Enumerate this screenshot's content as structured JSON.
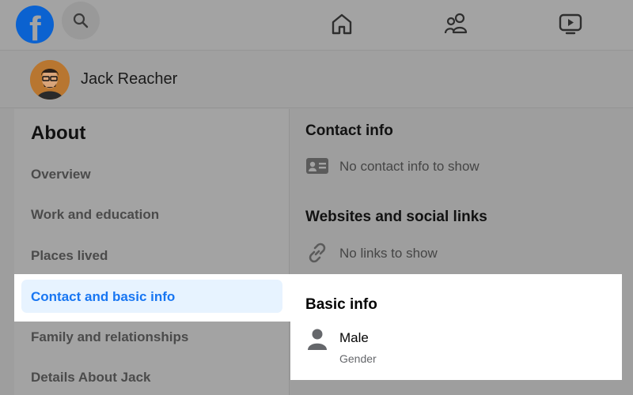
{
  "profile": {
    "name": "Jack Reacher"
  },
  "about": {
    "title": "About",
    "menu": [
      {
        "label": "Overview",
        "active": false
      },
      {
        "label": "Work and education",
        "active": false
      },
      {
        "label": "Places lived",
        "active": false
      },
      {
        "label": "Contact and basic info",
        "active": true
      },
      {
        "label": "Family and relationships",
        "active": false
      },
      {
        "label": "Details About Jack",
        "active": false
      }
    ]
  },
  "contact": {
    "title": "Contact info",
    "empty": "No contact info to show"
  },
  "websites": {
    "title": "Websites and social links",
    "empty": "No links to show"
  },
  "basic": {
    "title": "Basic info",
    "gender_value": "Male",
    "gender_label": "Gender"
  },
  "colors": {
    "brand": "#1876f2",
    "active_bg": "#e7f3ff",
    "overlay": "#a3a3a3"
  },
  "icons": {
    "logo": "facebook-logo",
    "search": "search-icon",
    "home": "home-icon",
    "friends": "friends-icon",
    "watch": "video-icon",
    "contact": "id-card-icon",
    "links": "link-icon",
    "gender": "person-icon"
  }
}
